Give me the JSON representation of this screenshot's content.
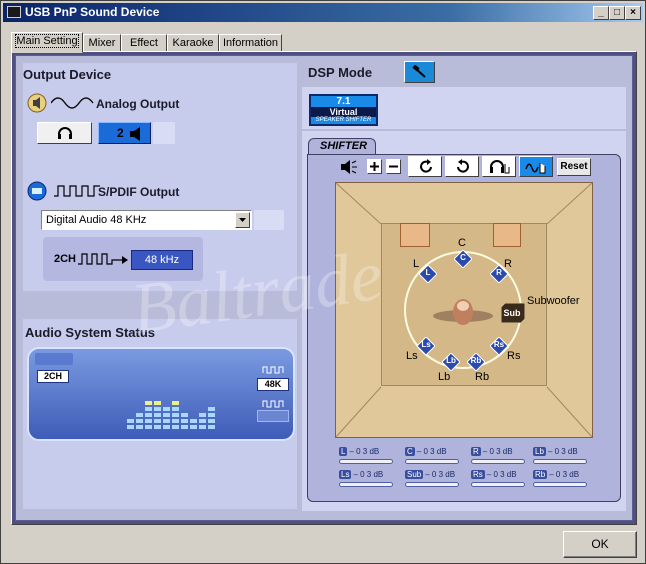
{
  "window": {
    "title": "USB PnP Sound Device"
  },
  "tabs": [
    {
      "label": "Main Setting"
    },
    {
      "label": "Mixer"
    },
    {
      "label": "Effect"
    },
    {
      "label": "Karaoke"
    },
    {
      "label": "Information"
    }
  ],
  "output_device": {
    "title": "Output Device",
    "analog_label": "Analog Output",
    "speaker_count": "2",
    "spdif_label": "S/PDIF Output",
    "spdif_select_value": "Digital Audio 48 KHz",
    "spdif_channel": "2CH",
    "spdif_rate": "48 kHz"
  },
  "audio_status": {
    "title": "Audio System Status",
    "channel": "2CH",
    "rate": "48K",
    "levels": [
      2,
      3,
      5,
      5,
      4,
      5,
      3,
      2,
      3,
      4
    ]
  },
  "dsp": {
    "title": "DSP Mode",
    "virtual_badge": {
      "top": "7.1",
      "middle": "Virtual",
      "bottom": "SPEAKER SHIFTER"
    },
    "shifter_tab": "SHIFTER",
    "reset_label": "Reset",
    "speakers": {
      "c": {
        "tag": "C",
        "label": "C"
      },
      "l": {
        "tag": "L",
        "label": "L"
      },
      "r": {
        "tag": "R",
        "label": "R"
      },
      "ls": {
        "tag": "Ls",
        "label": "Ls"
      },
      "rs": {
        "tag": "Rs",
        "label": "Rs"
      },
      "lb": {
        "tag": "Lb",
        "label": "Lb"
      },
      "rb": {
        "tag": "Rb",
        "label": "Rb"
      },
      "sub": {
        "tag": "Sub",
        "label": "Subwoofer"
      }
    },
    "volumes": [
      {
        "tag": "L",
        "value": "– 0 3 dB"
      },
      {
        "tag": "C",
        "value": "– 0 3 dB"
      },
      {
        "tag": "R",
        "value": "– 0 3 dB"
      },
      {
        "tag": "Lb",
        "value": "– 0 3 dB"
      },
      {
        "tag": "Ls",
        "value": "– 0 3 dB"
      },
      {
        "tag": "Sub",
        "value": "– 0 3 dB"
      },
      {
        "tag": "Rs",
        "value": "– 0 3 dB"
      },
      {
        "tag": "Rb",
        "value": "– 0 3 dB"
      }
    ]
  },
  "watermark": "Baltrade",
  "ok_label": "OK",
  "colors": {
    "accent": "#1a6ad8",
    "panel": "#c8ccec",
    "frame": "#4e4f83"
  }
}
